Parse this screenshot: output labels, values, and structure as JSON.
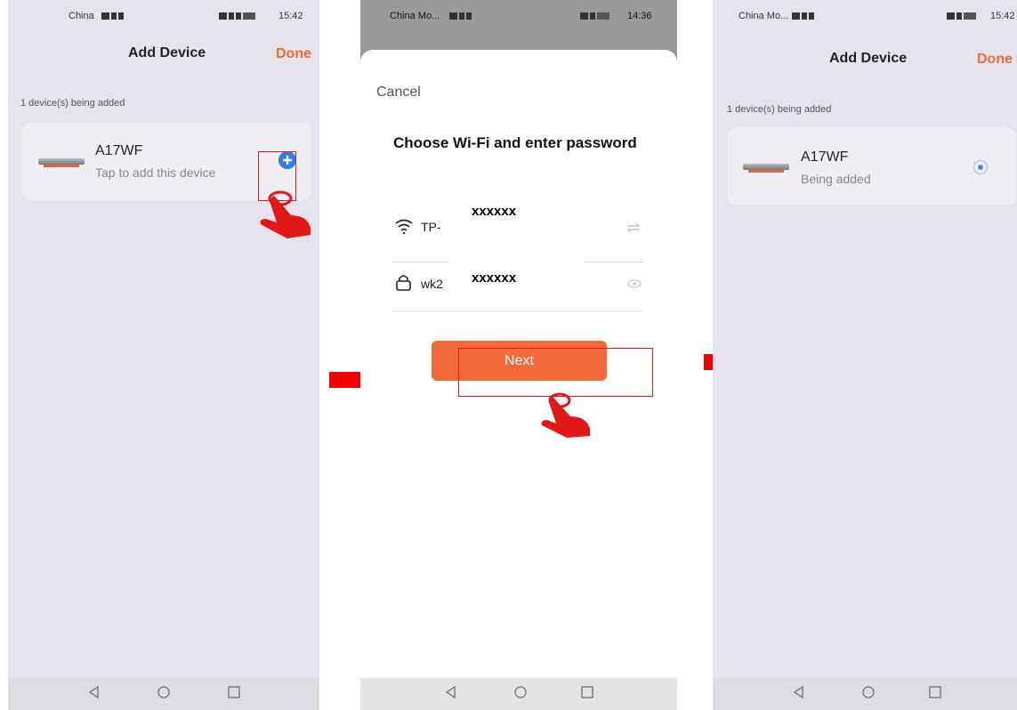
{
  "panel1": {
    "status": {
      "carrier": "China",
      "time": "15:42",
      "battery": "90"
    },
    "title": "Add Device",
    "done": "Done",
    "subtitle": "1 device(s) being added",
    "device": {
      "name": "A17WF",
      "action": "Tap to add this device"
    }
  },
  "panel2": {
    "status": {
      "carrier": "China Mo...",
      "time": "14:36"
    },
    "cancel": "Cancel",
    "heading": "Choose Wi-Fi and enter password",
    "wifi": {
      "prefix": "TP-",
      "mask": "xxxxxx"
    },
    "password": {
      "prefix": "wk2",
      "mask": "xxxxxx"
    },
    "next": "Next"
  },
  "panel3": {
    "status": {
      "carrier": "China Mo...",
      "time": "15:42",
      "battery": "90"
    },
    "title": "Add Device",
    "done": "Done",
    "subtitle": "1 device(s) being added",
    "device": {
      "name": "A17WF",
      "status": "Being added"
    }
  },
  "colors": {
    "accent": "#e96a3a",
    "next_button": "#f26a3a",
    "annotation_red": "#e01818",
    "add_icon": "#2f7fe6"
  }
}
